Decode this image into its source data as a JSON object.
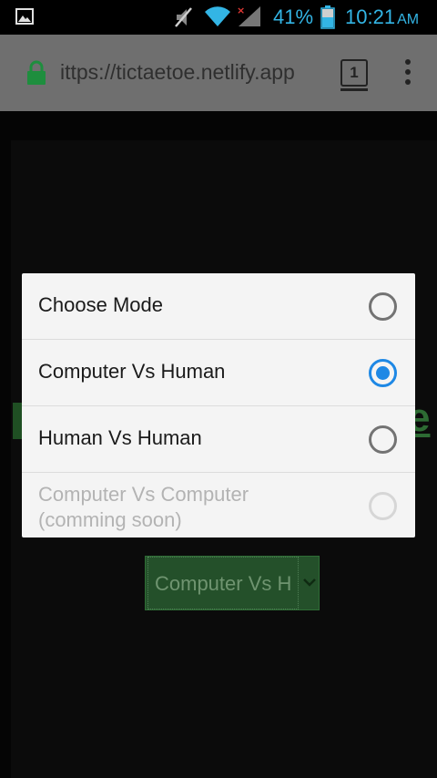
{
  "status_bar": {
    "battery_percent": "41%",
    "time": "10:21",
    "ampm": "AM",
    "icons": [
      "image-icon",
      "mute-icon",
      "wifi-icon",
      "signal-icon",
      "battery-icon"
    ]
  },
  "browser": {
    "url": "ittps://tictaetoe.netlify.app",
    "tab_count": "1"
  },
  "page": {
    "title_fragment": "e",
    "select_value": "Computer Vs H"
  },
  "dialog": {
    "options": [
      {
        "label": "Choose Mode",
        "checked": false,
        "disabled": false
      },
      {
        "label": "Computer Vs Human",
        "checked": true,
        "disabled": false
      },
      {
        "label": "Human Vs Human",
        "checked": false,
        "disabled": false
      },
      {
        "label": "Computer Vs Computer (comming soon)",
        "checked": false,
        "disabled": true
      }
    ]
  },
  "colors": {
    "accent": "#1e88e5",
    "status_text": "#33b5e5",
    "page_green": "#24502a"
  }
}
